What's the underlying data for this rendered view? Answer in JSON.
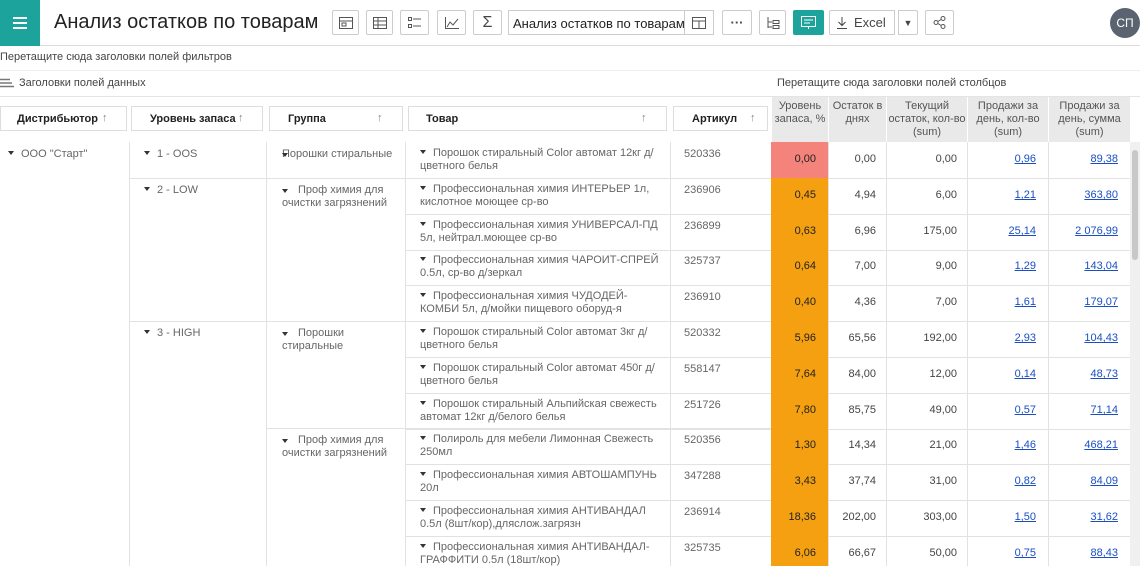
{
  "title": "Анализ остатков по товарам",
  "report_select": "Анализ остатков по товарам",
  "toolbar": {
    "excel_label": "Excel",
    "more_label": "···",
    "sigma_label": "Σ"
  },
  "user_initials": "СП",
  "filter_zone": "Перетащите сюда заголовки полей фильтров",
  "data_fields": "Заголовки полей данных",
  "column_zone": "Перетащите сюда заголовки полей столбцов",
  "colors": {
    "accent": "#1ba39c",
    "red": "#f4837b",
    "orange": "#f5a011",
    "link": "#1a4fc4"
  },
  "row_headers": [
    "Дистрибьютор",
    "Уровень запаса",
    "Группа",
    "Товар",
    "Артикул"
  ],
  "measures": [
    "Уровень запаса, %",
    "Остаток в днях",
    "Текущий остаток, кол-во (sum)",
    "Продажи за день, кол-во (sum)",
    "Продажи за день, сумма (sum)"
  ],
  "distributor": "ООО \"Старт\"",
  "levels": [
    "1 - OOS",
    "2 - LOW",
    "3 - HIGH"
  ],
  "groups": [
    "Порошки стиральные",
    "Проф химия для очистки загрязнений",
    "Порошки стиральные",
    "Проф химия для очистки загрязнений"
  ],
  "rows": [
    {
      "product": "Порошок стиральный Color автомат 12кг д/цветного белья",
      "sku": "520336",
      "pct": "0,00",
      "days": "0,00",
      "stock": "0,00",
      "qty": "0,96",
      "sum": "89,38",
      "level": "red"
    },
    {
      "product": "Профессиональная химия ИНТЕРЬЕР 1л, кислотное моющее ср-во",
      "sku": "236906",
      "pct": "0,45",
      "days": "4,94",
      "stock": "6,00",
      "qty": "1,21",
      "sum": "363,80",
      "level": "orange"
    },
    {
      "product": "Профессиональная химия УНИВЕРСАЛ-ПД 5л, нейтрал.моющее ср-во",
      "sku": "236899",
      "pct": "0,63",
      "days": "6,96",
      "stock": "175,00",
      "qty": "25,14",
      "sum": "2 076,99",
      "level": "orange"
    },
    {
      "product": "Профессиональная химия ЧАРОИТ-СПРЕЙ 0.5л, ср-во д/зеркал",
      "sku": "325737",
      "pct": "0,64",
      "days": "7,00",
      "stock": "9,00",
      "qty": "1,29",
      "sum": "143,04",
      "level": "orange"
    },
    {
      "product": "Профессиональная химия ЧУДОДЕЙ-КОМБИ 5л, д/мойки пищевого оборуд-я",
      "sku": "236910",
      "pct": "0,40",
      "days": "4,36",
      "stock": "7,00",
      "qty": "1,61",
      "sum": "179,07",
      "level": "orange"
    },
    {
      "product": "Порошок стиральный Color автомат 3кг д/цветного белья",
      "sku": "520332",
      "pct": "5,96",
      "days": "65,56",
      "stock": "192,00",
      "qty": "2,93",
      "sum": "104,43",
      "level": "orange"
    },
    {
      "product": "Порошок стиральный Color автомат 450г д/цветного белья",
      "sku": "558147",
      "pct": "7,64",
      "days": "84,00",
      "stock": "12,00",
      "qty": "0,14",
      "sum": "48,73",
      "level": "orange"
    },
    {
      "product": "Порошок стиральный Альпийская свежесть автомат 12кг д/белого белья",
      "sku": "251726",
      "pct": "7,80",
      "days": "85,75",
      "stock": "49,00",
      "qty": "0,57",
      "sum": "71,14",
      "level": "orange"
    },
    {
      "product": "Полироль для мебели Лимонная Свежесть 250мл",
      "sku": "520356",
      "pct": "1,30",
      "days": "14,34",
      "stock": "21,00",
      "qty": "1,46",
      "sum": "468,21",
      "level": "orange"
    },
    {
      "product": "Профессиональная химия АВТОШАМПУНЬ 20л",
      "sku": "347288",
      "pct": "3,43",
      "days": "37,74",
      "stock": "31,00",
      "qty": "0,82",
      "sum": "84,09",
      "level": "orange"
    },
    {
      "product": "Профессиональная химия АНТИВАНДАЛ 0.5л (8шт/кор),дляслож.загрязн",
      "sku": "236914",
      "pct": "18,36",
      "days": "202,00",
      "stock": "303,00",
      "qty": "1,50",
      "sum": "31,62",
      "level": "orange"
    },
    {
      "product": "Профессиональная химия АНТИВАНДАЛ-ГРАФФИТИ 0.5л (18шт/кор)",
      "sku": "325735",
      "pct": "6,06",
      "days": "66,67",
      "stock": "50,00",
      "qty": "0,75",
      "sum": "88,43",
      "level": "orange"
    }
  ]
}
